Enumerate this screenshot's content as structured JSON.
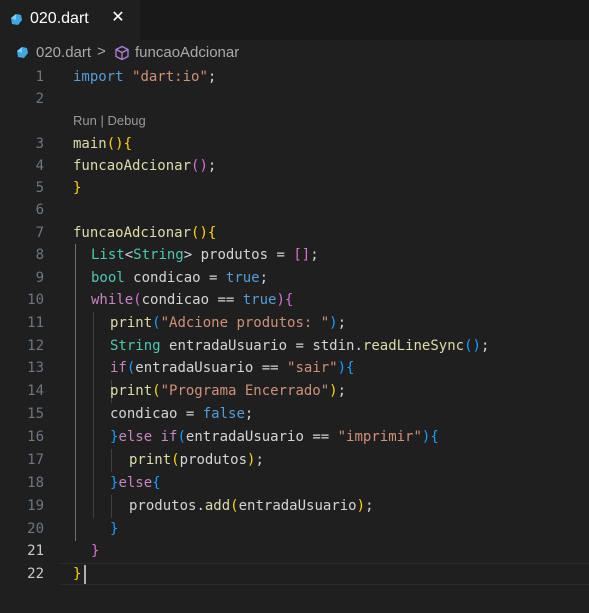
{
  "tab": {
    "label": "020.dart",
    "close": "✕",
    "icon": "dart-file-icon"
  },
  "breadcrumb": {
    "file": "020.dart",
    "separator": ">",
    "symbol": "funcaoAdcionar",
    "symbol_icon": "method-cube-icon"
  },
  "codelens": "Run | Debug",
  "line_numbers": [
    "1",
    "2",
    "3",
    "4",
    "5",
    "6",
    "7",
    "8",
    "9",
    "10",
    "11",
    "12",
    "13",
    "14",
    "15",
    "16",
    "17",
    "18",
    "19",
    "20",
    "21",
    "22"
  ],
  "active_line": "22",
  "code": {
    "l1": {
      "t1": "import",
      "t2": " ",
      "t3": "\"dart:io\"",
      "t4": ";"
    },
    "l3": {
      "t1": "main",
      "t2": "(",
      "t3": ")",
      "t4": "{"
    },
    "l4": {
      "t1": "funcaoAdcionar",
      "t2": "(",
      "t3": ")",
      "t4": ";"
    },
    "l5": {
      "t1": "}"
    },
    "l7": {
      "t1": "funcaoAdcionar",
      "t2": "(",
      "t3": ")",
      "t4": "{"
    },
    "l8": {
      "t1": "List",
      "t2": "<",
      "t3": "String",
      "t4": "> ",
      "t5": "produtos",
      "t6": " = ",
      "t7": "[",
      "t8": "]",
      "t9": ";"
    },
    "l9": {
      "t1": "bool",
      "t2": " ",
      "t3": "condicao",
      "t4": " = ",
      "t5": "true",
      "t6": ";"
    },
    "l10": {
      "t1": "while",
      "t2": "(",
      "t3": "condicao",
      "t4": " == ",
      "t5": "true",
      "t6": ")",
      "t7": "{"
    },
    "l11": {
      "t1": "print",
      "t2": "(",
      "t3": "\"Adcione produtos: \"",
      "t4": ")",
      "t5": ";"
    },
    "l12": {
      "t1": "String",
      "t2": " ",
      "t3": "entradaUsuario",
      "t4": " = ",
      "t5": "stdin",
      "t6": ".",
      "t7": "readLineSync",
      "t8": "(",
      "t9": ")",
      "t10": ";"
    },
    "l13": {
      "t1": "if",
      "t2": "(",
      "t3": "entradaUsuario",
      "t4": " == ",
      "t5": "\"sair\"",
      "t6": ")",
      "t7": "{"
    },
    "l14": {
      "t1": "print",
      "t2": "(",
      "t3": "\"Programa Encerrado\"",
      "t4": ")",
      "t5": ";"
    },
    "l15": {
      "t1": "condicao",
      "t2": " = ",
      "t3": "false",
      "t4": ";"
    },
    "l16": {
      "t1": "}",
      "t2": "else",
      "t3": " ",
      "t4": "if",
      "t5": "(",
      "t6": "entradaUsuario",
      "t7": " == ",
      "t8": "\"imprimir\"",
      "t9": ")",
      "t10": "{"
    },
    "l17": {
      "t1": "print",
      "t2": "(",
      "t3": "produtos",
      "t4": ")",
      "t5": ";"
    },
    "l18": {
      "t1": "}",
      "t2": "else",
      "t3": "{"
    },
    "l19": {
      "t1": "produtos",
      "t2": ".",
      "t3": "add",
      "t4": "(",
      "t5": "entradaUsuario",
      "t6": ")",
      "t7": ";"
    },
    "l20": {
      "t1": "}"
    },
    "l21": {
      "t1": "}"
    },
    "l22": {
      "t1": "}"
    }
  }
}
